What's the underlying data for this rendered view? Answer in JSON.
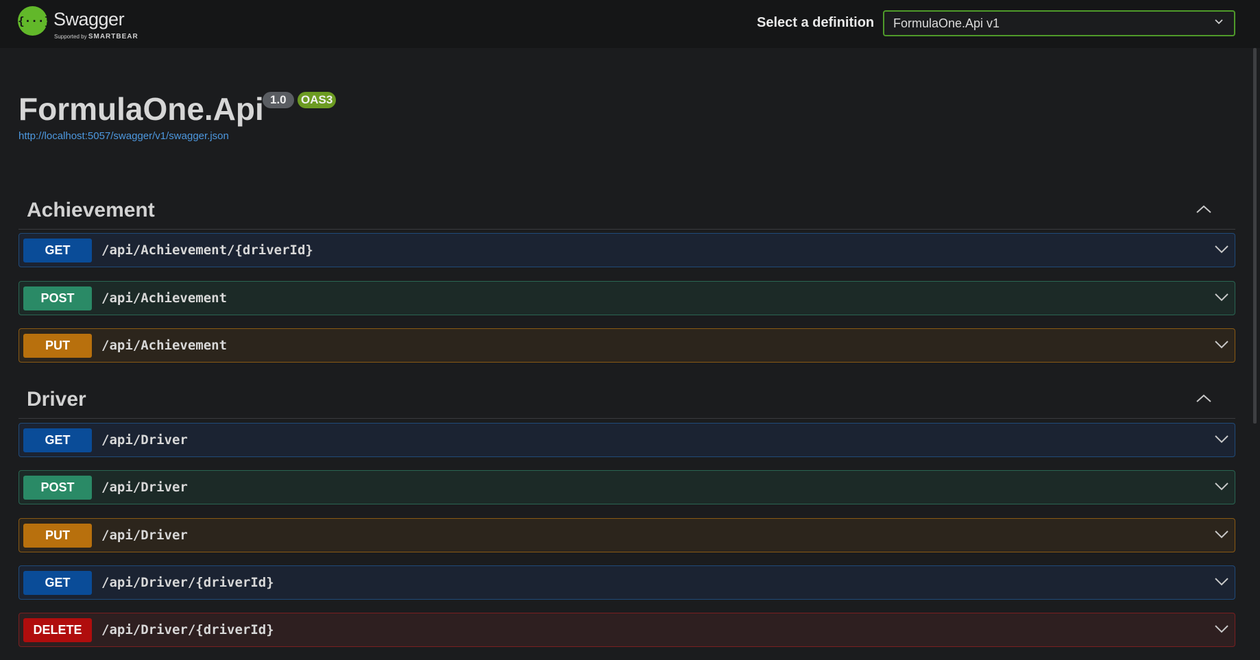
{
  "header": {
    "brand_name": "Swagger",
    "brand_tagline_prefix": "Supported by",
    "brand_tagline_company": "SMARTBEAR",
    "logo_glyph": "{···}",
    "definition_label": "Select a definition",
    "definition_value": "FormulaOne.Api v1"
  },
  "info": {
    "title": "FormulaOne.Api",
    "version": "1.0",
    "oas_badge": "OAS3",
    "spec_url": "http://localhost:5057/swagger/v1/swagger.json"
  },
  "sections": [
    {
      "name": "Achievement",
      "operations": [
        {
          "method": "GET",
          "path": "/api/Achievement/{driverId}"
        },
        {
          "method": "POST",
          "path": "/api/Achievement"
        },
        {
          "method": "PUT",
          "path": "/api/Achievement"
        }
      ]
    },
    {
      "name": "Driver",
      "operations": [
        {
          "method": "GET",
          "path": "/api/Driver"
        },
        {
          "method": "POST",
          "path": "/api/Driver"
        },
        {
          "method": "PUT",
          "path": "/api/Driver"
        },
        {
          "method": "GET",
          "path": "/api/Driver/{driverId}"
        },
        {
          "method": "DELETE",
          "path": "/api/Driver/{driverId}"
        }
      ]
    }
  ],
  "colors": {
    "get": "#0a4c98",
    "post": "#2a8a66",
    "put": "#b8700d",
    "delete": "#b00d0d",
    "brand": "#62b82a"
  },
  "icons": {
    "select_chevron": "chevron-down-icon",
    "section_toggle": "chevron-up-icon",
    "operation_toggle": "chevron-down-icon"
  }
}
